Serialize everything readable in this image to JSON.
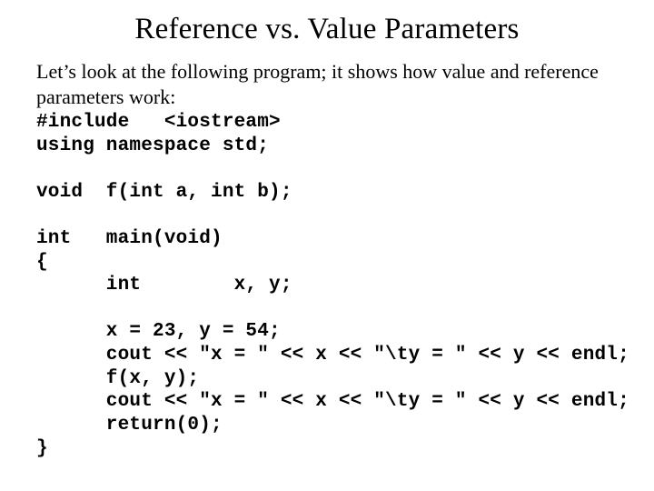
{
  "title": "Reference vs. Value Parameters",
  "intro": "Let’s look at the following program; it shows how value and reference parameters work:",
  "code": {
    "l1": "#include   <iostream>",
    "l2": "using namespace std;",
    "l3": "",
    "l4": "void  f(int a, int b);",
    "l5": "",
    "l6": "int   main(void)",
    "l7": "{",
    "l8": "      int        x, y;",
    "l9": "",
    "l10": "      x = 23, y = 54;",
    "l11": "      cout << \"x = \" << x << \"\\ty = \" << y << endl;",
    "l12": "      f(x, y);",
    "l13": "      cout << \"x = \" << x << \"\\ty = \" << y << endl;",
    "l14": "      return(0);",
    "l15": "}"
  }
}
